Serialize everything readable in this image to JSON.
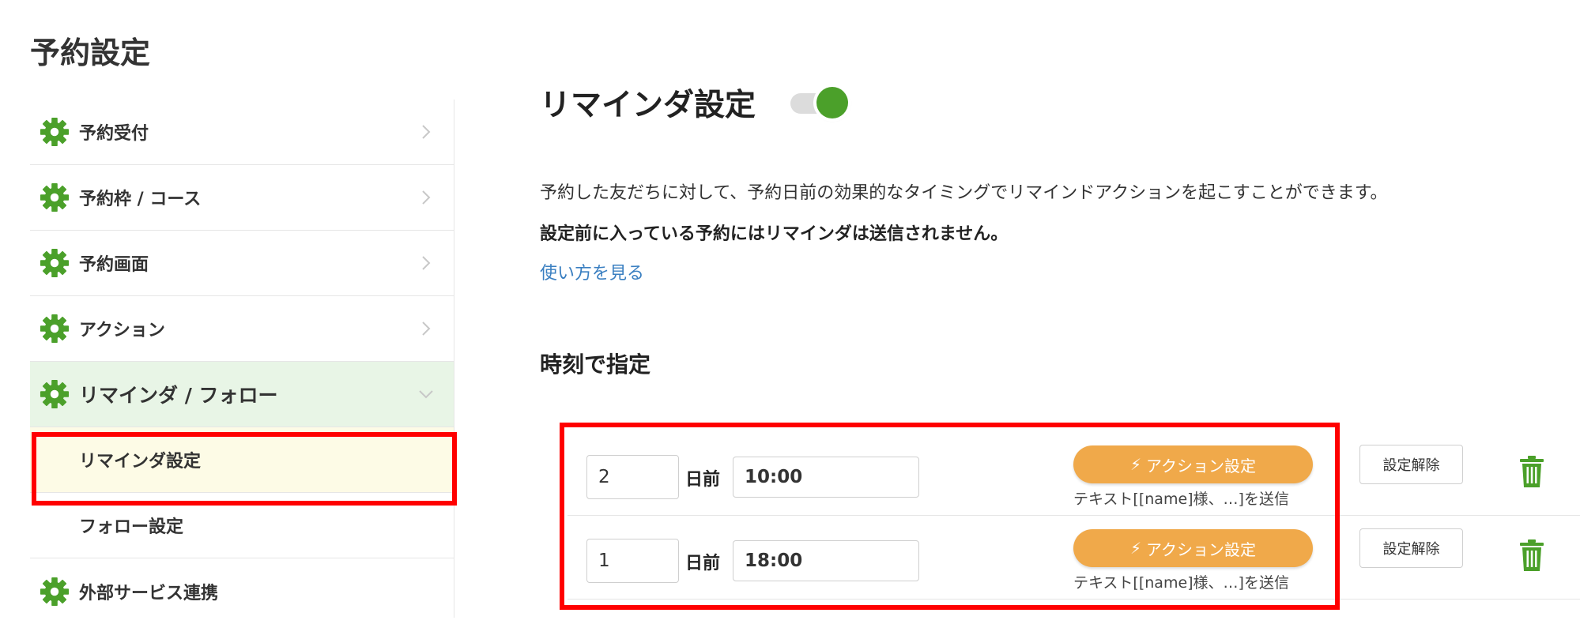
{
  "page": {
    "title": "予約設定"
  },
  "sidebar": {
    "items": [
      {
        "label": "予約受付"
      },
      {
        "label": "予約枠 / コース"
      },
      {
        "label": "予約画面"
      },
      {
        "label": "アクション"
      },
      {
        "label": "リマインダ / フォロー"
      },
      {
        "label": "外部サービス連携"
      }
    ],
    "subitems": [
      {
        "label": "リマインダ設定"
      },
      {
        "label": "フォロー設定"
      }
    ]
  },
  "main": {
    "title": "リマインダ設定",
    "toggle_on": true,
    "description": "予約した友だちに対して、予約日前の効果的なタイミングでリマインドアクションを起こすことができます。",
    "notice": "設定前に入っている予約にはリマインダは送信されません。",
    "help_link": "使い方を見る",
    "section": "時刻で指定",
    "rows": [
      {
        "days": "2",
        "days_label": "日前",
        "time": "10:00",
        "action_label": "アクション設定",
        "action_desc": "テキスト[[name]様、…]を送信",
        "unset_label": "設定解除"
      },
      {
        "days": "1",
        "days_label": "日前",
        "time": "18:00",
        "action_label": "アクション設定",
        "action_desc": "テキスト[[name]様、…]を送信",
        "unset_label": "設定解除"
      }
    ]
  },
  "icons": {
    "gear": "gear-icon",
    "chevron_right": "chevron-right-icon",
    "chevron_down": "chevron-down-icon",
    "bolt": "lightning-icon",
    "trash": "trash-icon"
  },
  "colors": {
    "brand_green": "#4ba02a",
    "active_bg": "#e8f5e6",
    "selected_bg": "#fdfbe6",
    "action_orange": "#f0a94a",
    "link_blue": "#3a7fc1",
    "annotation_red": "#ff0000"
  }
}
